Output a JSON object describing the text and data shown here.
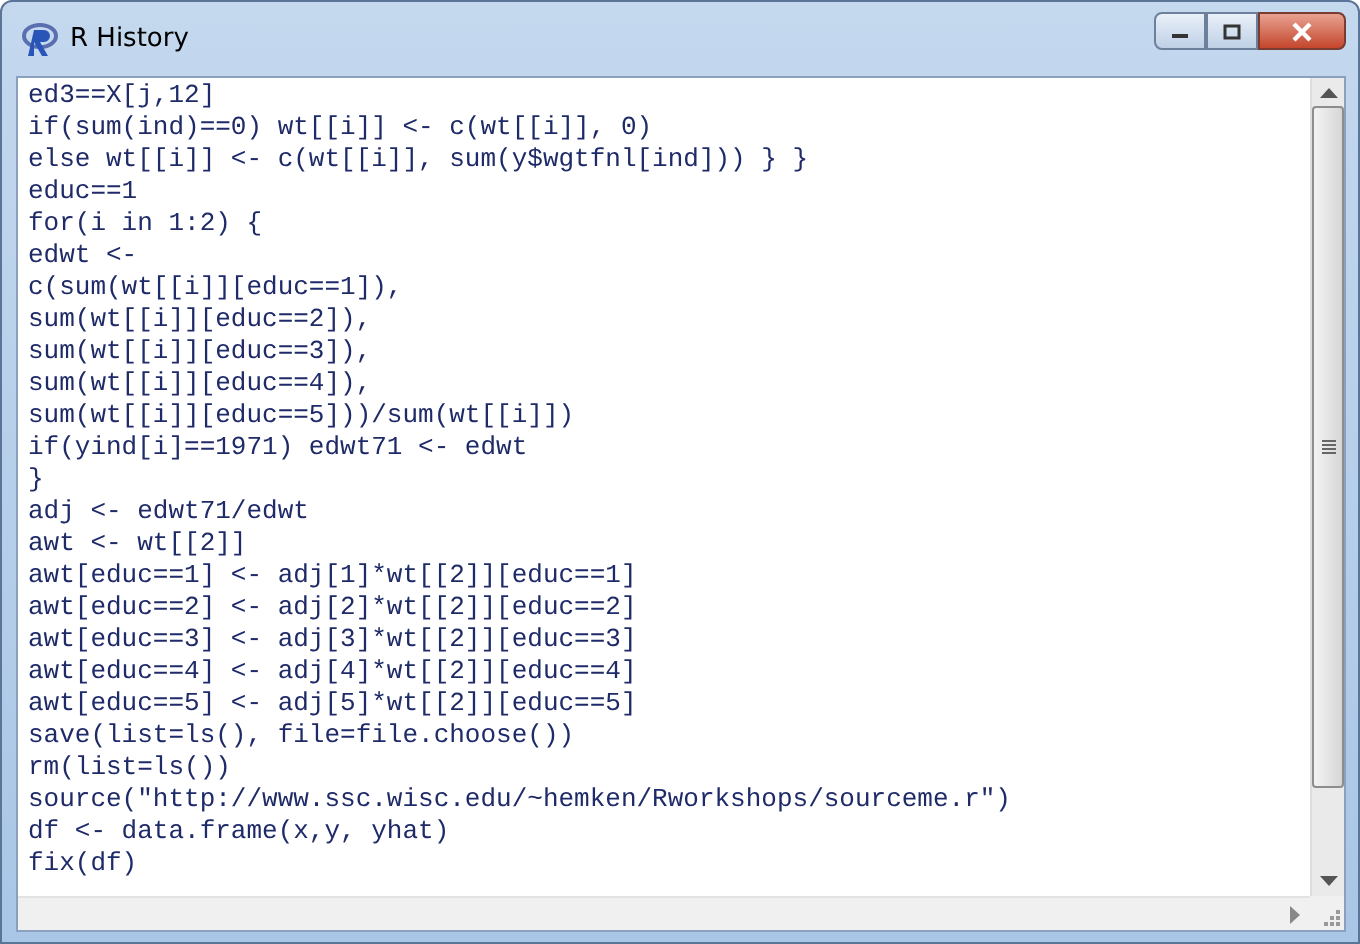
{
  "window": {
    "title": "R History"
  },
  "history_lines": [
    "ed3==X[j,12]",
    "if(sum(ind)==0) wt[[i]] <- c(wt[[i]], 0)",
    "else wt[[i]] <- c(wt[[i]], sum(y$wgtfnl[ind])) } }",
    "educ==1",
    "for(i in 1:2) {",
    "edwt <-",
    "c(sum(wt[[i]][educ==1]),",
    "sum(wt[[i]][educ==2]),",
    "sum(wt[[i]][educ==3]),",
    "sum(wt[[i]][educ==4]),",
    "sum(wt[[i]][educ==5]))/sum(wt[[i]])",
    "if(yind[i]==1971) edwt71 <- edwt",
    "}",
    "adj <- edwt71/edwt",
    "awt <- wt[[2]]",
    "awt[educ==1] <- adj[1]*wt[[2]][educ==1]",
    "awt[educ==2] <- adj[2]*wt[[2]][educ==2]",
    "awt[educ==3] <- adj[3]*wt[[2]][educ==3]",
    "awt[educ==4] <- adj[4]*wt[[2]][educ==4]",
    "awt[educ==5] <- adj[5]*wt[[2]][educ==5]",
    "save(list=ls(), file=file.choose())",
    "rm(list=ls())",
    "source(\"http://www.ssc.wisc.edu/~hemken/Rworkshops/sourceme.r\")",
    "df <- data.frame(x,y, yhat)",
    "fix(df)"
  ]
}
